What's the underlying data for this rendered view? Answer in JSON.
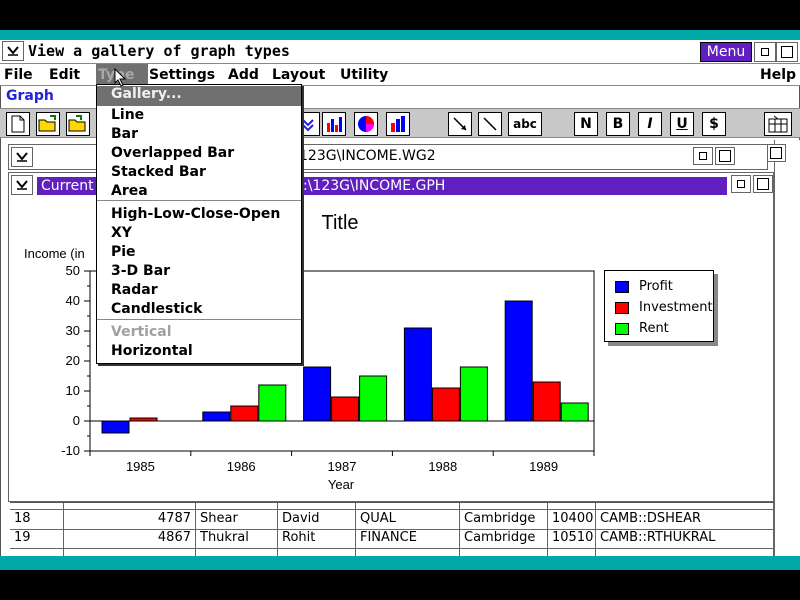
{
  "window": {
    "title": "View a gallery of graph types",
    "menu_button": "Menu",
    "help": "Help"
  },
  "menubar": {
    "items": [
      "File",
      "Edit",
      "Type",
      "Settings",
      "Add",
      "Layout",
      "Utility"
    ]
  },
  "context_label": "Graph",
  "toolbar": {
    "text_tool": "abc",
    "normal": "N",
    "bold": "B",
    "italic": "I",
    "underline": "U",
    "currency": "$"
  },
  "windows": {
    "worksheet_title": "123G\\INCOME.WG2",
    "graph_title_left": "Current",
    "graph_title_right": ":\\123G\\INCOME.GPH"
  },
  "type_menu": {
    "items": [
      {
        "label": "Gallery...",
        "selected": true
      },
      {
        "label": "Line"
      },
      {
        "label": "Bar"
      },
      {
        "label": "Overlapped Bar"
      },
      {
        "label": "Stacked Bar"
      },
      {
        "label": "Area"
      },
      {
        "label": "High-Low-Close-Open"
      },
      {
        "label": "XY"
      },
      {
        "label": "Pie"
      },
      {
        "label": "3-D Bar"
      },
      {
        "label": "Radar"
      },
      {
        "label": "Candlestick"
      },
      {
        "label": "Vertical",
        "disabled": true
      },
      {
        "label": "Horizontal"
      }
    ]
  },
  "chart_data": {
    "type": "bar",
    "title": "Title",
    "xlabel": "Year",
    "ylabel": "Income  (in",
    "categories": [
      "1985",
      "1986",
      "1987",
      "1988",
      "1989"
    ],
    "series": [
      {
        "name": "Profit",
        "color": "#0000ff",
        "values": [
          -4,
          3,
          18,
          31,
          40
        ]
      },
      {
        "name": "Investment",
        "color": "#ff0000",
        "values": [
          1,
          5,
          8,
          11,
          13
        ]
      },
      {
        "name": "Rent",
        "color": "#00ff00",
        "values": [
          0,
          12,
          15,
          18,
          6
        ]
      }
    ],
    "ylim": [
      -10,
      50
    ],
    "yticks": [
      "-10",
      "0",
      "10",
      "20",
      "30",
      "40",
      "50"
    ],
    "legend": "right"
  },
  "table": {
    "rows": [
      [
        "18",
        "4787",
        "Shear",
        "David",
        "QUAL",
        "Cambridge",
        "10400",
        "CAMB::DSHEAR"
      ],
      [
        "19",
        "4867",
        "Thukral",
        "Rohit",
        "FINANCE",
        "Cambridge",
        "10510",
        "CAMB::RTHUKRAL"
      ]
    ]
  }
}
